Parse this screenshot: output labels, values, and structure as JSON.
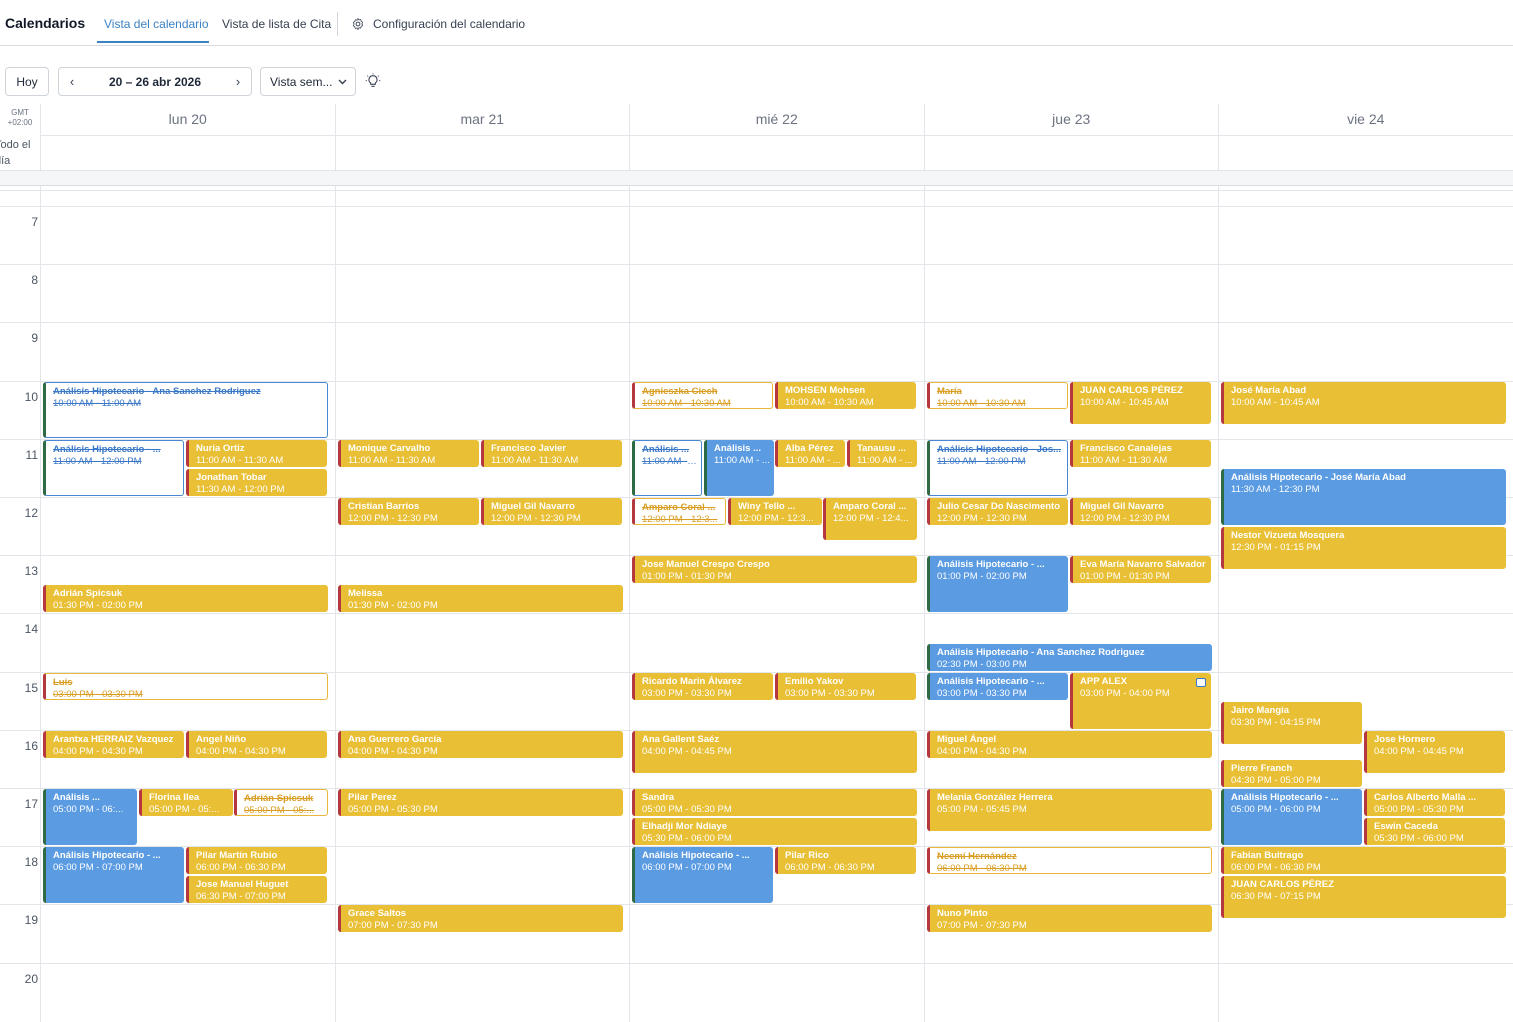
{
  "header": {
    "title": "Calendarios",
    "tabs": [
      {
        "label": "Vista del calendario"
      },
      {
        "label": "Vista de lista de Cita"
      },
      {
        "label": "Configuración del calendario"
      }
    ]
  },
  "toolbar": {
    "today_label": "Hoy",
    "date_range": "20 – 26 abr 2026",
    "prev_icon": "‹",
    "next_icon": "›",
    "view_select": "Vista sem...",
    "icons": [
      "gear-icon",
      "lightbulb-icon",
      "chevron-left-icon",
      "chevron-right-icon",
      "chevron-down-icon"
    ]
  },
  "grid": {
    "timezone": "GMT +02:00",
    "all_day_label": "Todo el día",
    "days": [
      "lun 20",
      "mar 21",
      "mié 22",
      "jue 23",
      "vie 24"
    ],
    "hours": [
      "7",
      "8",
      "9",
      "10",
      "11",
      "12",
      "13",
      "14",
      "15",
      "16",
      "17",
      "18",
      "19",
      "20"
    ]
  },
  "colors": {
    "accent": "#3b82c4",
    "event_yellow": "#e9bf35",
    "event_blue": "#5b9be2",
    "stripe_red": "#b6383f",
    "stripe_green": "#2f6a44"
  },
  "events": [
    {
      "day": 0,
      "start": 10,
      "end": 11,
      "col": 0,
      "cols": 1,
      "title": "Análisis Hipotecario - Ana Sanchez Rodriguez",
      "time": "10:00 AM - 11:00 AM",
      "style": "outline-blue",
      "strike": true
    },
    {
      "day": 0,
      "start": 11,
      "end": 12,
      "col": 0,
      "cols": 2,
      "title": "Análisis Hipotecario - ...",
      "time": "11:00 AM - 12:00 PM",
      "style": "outline-blue",
      "strike": true
    },
    {
      "day": 0,
      "start": 11,
      "end": 11.5,
      "col": 1,
      "cols": 2,
      "title": "Nuria Ortiz",
      "time": "11:00 AM - 11:30 AM",
      "style": "yellow"
    },
    {
      "day": 0,
      "start": 11.5,
      "end": 12,
      "col": 1,
      "cols": 2,
      "title": "Jonathan Tobar",
      "time": "11:30 AM - 12:00 PM",
      "style": "yellow"
    },
    {
      "day": 0,
      "start": 13.5,
      "end": 14,
      "col": 0,
      "cols": 1,
      "title": "Adrián Spicsuk",
      "time": "01:30 PM - 02:00 PM",
      "style": "yellow"
    },
    {
      "day": 0,
      "start": 15,
      "end": 15.5,
      "col": 0,
      "cols": 1,
      "title": "Luis",
      "time": "03:00 PM - 03:30 PM",
      "style": "outline-yellow",
      "strike": true
    },
    {
      "day": 0,
      "start": 16,
      "end": 16.5,
      "col": 0,
      "cols": 2,
      "title": "Arantxa HERRAIZ Vazquez",
      "time": "04:00 PM - 04:30 PM",
      "style": "yellow"
    },
    {
      "day": 0,
      "start": 16,
      "end": 16.5,
      "col": 1,
      "cols": 2,
      "title": "Angel Niño",
      "time": "04:00 PM - 04:30 PM",
      "style": "yellow"
    },
    {
      "day": 0,
      "start": 17,
      "end": 18,
      "col": 0,
      "cols": 3,
      "title": "Análisis ...",
      "time": "05:00 PM - 06:...",
      "style": "blue"
    },
    {
      "day": 0,
      "start": 17,
      "end": 17.5,
      "col": 1,
      "cols": 3,
      "title": "Florina Ilea",
      "time": "05:00 PM - 05:...",
      "style": "yellow"
    },
    {
      "day": 0,
      "start": 17,
      "end": 17.5,
      "col": 2,
      "cols": 3,
      "title": "Adrián Spicsuk",
      "time": "05:00 PM - 05:...",
      "style": "outline-yellow",
      "strike": true
    },
    {
      "day": 0,
      "start": 18,
      "end": 19,
      "col": 0,
      "cols": 2,
      "title": "Análisis Hipotecario - ...",
      "time": "06:00 PM - 07:00 PM",
      "style": "blue"
    },
    {
      "day": 0,
      "start": 18,
      "end": 18.5,
      "col": 1,
      "cols": 2,
      "title": "Pilar Martín Rubio",
      "time": "06:00 PM - 06:30 PM",
      "style": "yellow"
    },
    {
      "day": 0,
      "start": 18.5,
      "end": 19,
      "col": 1,
      "cols": 2,
      "title": "Jose Manuel Huguet",
      "time": "06:30 PM - 07:00 PM",
      "style": "yellow"
    },
    {
      "day": 1,
      "start": 11,
      "end": 11.5,
      "col": 0,
      "cols": 2,
      "title": "Monique Carvalho",
      "time": "11:00 AM - 11:30 AM",
      "style": "yellow"
    },
    {
      "day": 1,
      "start": 11,
      "end": 11.5,
      "col": 1,
      "cols": 2,
      "title": "Francisco Javier",
      "time": "11:00 AM - 11:30 AM",
      "style": "yellow"
    },
    {
      "day": 1,
      "start": 12,
      "end": 12.5,
      "col": 0,
      "cols": 2,
      "title": "Cristian Barrios",
      "time": "12:00 PM - 12:30 PM",
      "style": "yellow"
    },
    {
      "day": 1,
      "start": 12,
      "end": 12.5,
      "col": 1,
      "cols": 2,
      "title": "Miguel Gil Navarro",
      "time": "12:00 PM - 12:30 PM",
      "style": "yellow"
    },
    {
      "day": 1,
      "start": 13.5,
      "end": 14,
      "col": 0,
      "cols": 1,
      "title": "Melissa",
      "time": "01:30 PM - 02:00 PM",
      "style": "yellow"
    },
    {
      "day": 1,
      "start": 16,
      "end": 16.5,
      "col": 0,
      "cols": 1,
      "title": "Ana Guerrero García",
      "time": "04:00 PM - 04:30 PM",
      "style": "yellow"
    },
    {
      "day": 1,
      "start": 17,
      "end": 17.5,
      "col": 0,
      "cols": 1,
      "title": "Pilar Perez",
      "time": "05:00 PM - 05:30 PM",
      "style": "yellow"
    },
    {
      "day": 1,
      "start": 19,
      "end": 19.5,
      "col": 0,
      "cols": 1,
      "title": "Grace Saltos",
      "time": "07:00 PM - 07:30 PM",
      "style": "yellow"
    },
    {
      "day": 2,
      "start": 10,
      "end": 10.5,
      "col": 0,
      "cols": 2,
      "title": "Agnieszka Ciech",
      "time": "10:00 AM - 10:30 AM",
      "style": "outline-yellow",
      "strike": true
    },
    {
      "day": 2,
      "start": 10,
      "end": 10.5,
      "col": 1,
      "cols": 2,
      "title": "MOHSEN Mohsen",
      "time": "10:00 AM - 10:30 AM",
      "style": "yellow"
    },
    {
      "day": 2,
      "start": 11,
      "end": 12,
      "col": 0,
      "cols": 4,
      "title": "Análisis ...",
      "time": "11:00 AM - ...",
      "style": "outline-blue",
      "strike": true
    },
    {
      "day": 2,
      "start": 11,
      "end": 12,
      "col": 1,
      "cols": 4,
      "title": "Análisis ...",
      "time": "11:00 AM - ...",
      "style": "blue"
    },
    {
      "day": 2,
      "start": 11,
      "end": 11.5,
      "col": 2,
      "cols": 4,
      "title": "Alba Pérez",
      "time": "11:00 AM - ...",
      "style": "yellow"
    },
    {
      "day": 2,
      "start": 11,
      "end": 11.5,
      "col": 3,
      "cols": 4,
      "title": "Tanausu ...",
      "time": "11:00 AM - ...",
      "style": "yellow"
    },
    {
      "day": 2,
      "start": 12,
      "end": 12.5,
      "col": 0,
      "cols": 3,
      "title": "Amparo Coral ...",
      "time": "12:00 PM - 12:3...",
      "style": "outline-yellow",
      "strike": true
    },
    {
      "day": 2,
      "start": 12,
      "end": 12.5,
      "col": 1,
      "cols": 3,
      "title": "Winy Tello ...",
      "time": "12:00 PM - 12:3...",
      "style": "yellow"
    },
    {
      "day": 2,
      "start": 12,
      "end": 12.75,
      "col": 2,
      "cols": 3,
      "title": "Amparo Coral ...",
      "time": "12:00 PM - 12:4...",
      "style": "yellow"
    },
    {
      "day": 2,
      "start": 13,
      "end": 13.5,
      "col": 0,
      "cols": 1,
      "title": "Jose Manuel Crespo Crespo",
      "time": "01:00 PM - 01:30 PM",
      "style": "yellow"
    },
    {
      "day": 2,
      "start": 15,
      "end": 15.5,
      "col": 0,
      "cols": 2,
      "title": "Ricardo Marin Álvarez",
      "time": "03:00 PM - 03:30 PM",
      "style": "yellow"
    },
    {
      "day": 2,
      "start": 15,
      "end": 15.5,
      "col": 1,
      "cols": 2,
      "title": "Emilio Yakov",
      "time": "03:00 PM - 03:30 PM",
      "style": "yellow"
    },
    {
      "day": 2,
      "start": 16,
      "end": 16.75,
      "col": 0,
      "cols": 1,
      "title": "Ana Gallent Saéz",
      "time": "04:00 PM - 04:45 PM",
      "style": "yellow"
    },
    {
      "day": 2,
      "start": 17,
      "end": 17.5,
      "col": 0,
      "cols": 1,
      "title": "Sandra",
      "time": "05:00 PM - 05:30 PM",
      "style": "yellow"
    },
    {
      "day": 2,
      "start": 17.5,
      "end": 18,
      "col": 0,
      "cols": 1,
      "title": "Elhadji Mor Ndiaye",
      "time": "05:30 PM - 06:00 PM",
      "style": "yellow"
    },
    {
      "day": 2,
      "start": 18,
      "end": 19,
      "col": 0,
      "cols": 2,
      "title": "Análisis Hipotecario - ...",
      "time": "06:00 PM - 07:00 PM",
      "style": "blue"
    },
    {
      "day": 2,
      "start": 18,
      "end": 18.5,
      "col": 1,
      "cols": 2,
      "title": "Pilar Rico",
      "time": "06:00 PM - 06:30 PM",
      "style": "yellow"
    },
    {
      "day": 3,
      "start": 10,
      "end": 10.5,
      "col": 0,
      "cols": 2,
      "title": "María",
      "time": "10:00 AM - 10:30 AM",
      "style": "outline-yellow",
      "strike": true
    },
    {
      "day": 3,
      "start": 10,
      "end": 10.75,
      "col": 1,
      "cols": 2,
      "title": "JUAN CARLOS PÉREZ",
      "time": "10:00 AM - 10:45 AM",
      "style": "yellow"
    },
    {
      "day": 3,
      "start": 11,
      "end": 12,
      "col": 0,
      "cols": 2,
      "title": "Análisis Hipotecario - Jos...",
      "time": "11:00 AM - 12:00 PM",
      "style": "outline-blue",
      "strike": true
    },
    {
      "day": 3,
      "start": 11,
      "end": 11.5,
      "col": 1,
      "cols": 2,
      "title": "Francisco Canalejas",
      "time": "11:00 AM - 11:30 AM",
      "style": "yellow"
    },
    {
      "day": 3,
      "start": 12,
      "end": 12.5,
      "col": 0,
      "cols": 2,
      "title": "Julio Cesar Do Nascimento",
      "time": "12:00 PM - 12:30 PM",
      "style": "yellow"
    },
    {
      "day": 3,
      "start": 12,
      "end": 12.5,
      "col": 1,
      "cols": 2,
      "title": "Miguel Gil Navarro",
      "time": "12:00 PM - 12:30 PM",
      "style": "yellow"
    },
    {
      "day": 3,
      "start": 13,
      "end": 14,
      "col": 0,
      "cols": 2,
      "title": "Análisis Hipotecario - ...",
      "time": "01:00 PM - 02:00 PM",
      "style": "blue"
    },
    {
      "day": 3,
      "start": 13,
      "end": 13.5,
      "col": 1,
      "cols": 2,
      "title": "Eva María Navarro Salvador",
      "time": "01:00 PM - 01:30 PM",
      "style": "yellow"
    },
    {
      "day": 3,
      "start": 14.5,
      "end": 15,
      "col": 0,
      "cols": 1,
      "title": "Análisis Hipotecario - Ana Sanchez Rodriguez",
      "time": "02:30 PM - 03:00 PM",
      "style": "blue"
    },
    {
      "day": 3,
      "start": 15,
      "end": 15.5,
      "col": 0,
      "cols": 2,
      "title": "Análisis Hipotecario - ...",
      "time": "03:00 PM - 03:30 PM",
      "style": "blue"
    },
    {
      "day": 3,
      "start": 15,
      "end": 16,
      "col": 1,
      "cols": 2,
      "title": "APP ALEX",
      "time": "03:00 PM - 04:00 PM",
      "style": "yellow",
      "chat": true
    },
    {
      "day": 3,
      "start": 16,
      "end": 16.5,
      "col": 0,
      "cols": 1,
      "title": "Miguel Ángel",
      "time": "04:00 PM - 04:30 PM",
      "style": "yellow"
    },
    {
      "day": 3,
      "start": 17,
      "end": 17.75,
      "col": 0,
      "cols": 1,
      "title": "Melania González Herrera",
      "time": "05:00 PM - 05:45 PM",
      "style": "yellow"
    },
    {
      "day": 3,
      "start": 18,
      "end": 18.5,
      "col": 0,
      "cols": 1,
      "title": "Neemí Hernández",
      "time": "06:00 PM - 06:30 PM",
      "style": "outline-yellow",
      "strike": true
    },
    {
      "day": 3,
      "start": 19,
      "end": 19.5,
      "col": 0,
      "cols": 1,
      "title": "Nuno Pinto",
      "time": "07:00 PM - 07:30 PM",
      "style": "yellow"
    },
    {
      "day": 4,
      "start": 10,
      "end": 10.75,
      "col": 0,
      "cols": 1,
      "title": "José María Abad",
      "time": "10:00 AM - 10:45 AM",
      "style": "yellow"
    },
    {
      "day": 4,
      "start": 11.5,
      "end": 12.5,
      "col": 0,
      "cols": 1,
      "title": "Análisis Hipotecario - José María Abad",
      "time": "11:30 AM - 12:30 PM",
      "style": "blue"
    },
    {
      "day": 4,
      "start": 12.5,
      "end": 13.25,
      "col": 0,
      "cols": 1,
      "title": "Nestor Vizueta Mosquera",
      "time": "12:30 PM - 01:15 PM",
      "style": "yellow"
    },
    {
      "day": 4,
      "start": 15.5,
      "end": 16.25,
      "col": 0,
      "cols": 2,
      "title": "Jairo Mangia",
      "time": "03:30 PM - 04:15 PM",
      "style": "yellow"
    },
    {
      "day": 4,
      "start": 16,
      "end": 16.75,
      "col": 1,
      "cols": 2,
      "title": "Jose Hornero",
      "time": "04:00 PM - 04:45 PM",
      "style": "yellow"
    },
    {
      "day": 4,
      "start": 16.5,
      "end": 17,
      "col": 0,
      "cols": 2,
      "title": "Pierre Franch",
      "time": "04:30 PM - 05:00 PM",
      "style": "yellow"
    },
    {
      "day": 4,
      "start": 17,
      "end": 18,
      "col": 0,
      "cols": 2,
      "title": "Análisis Hipotecario - ...",
      "time": "05:00 PM - 06:00 PM",
      "style": "blue"
    },
    {
      "day": 4,
      "start": 17,
      "end": 17.5,
      "col": 1,
      "cols": 2,
      "title": "Carlos Alberto Malla ...",
      "time": "05:00 PM - 05:30 PM",
      "style": "yellow"
    },
    {
      "day": 4,
      "start": 17.5,
      "end": 18,
      "col": 1,
      "cols": 2,
      "title": "Eswin Caceda",
      "time": "05:30 PM - 06:00 PM",
      "style": "yellow"
    },
    {
      "day": 4,
      "start": 18,
      "end": 18.5,
      "col": 0,
      "cols": 1,
      "title": "Fabian Buitrago",
      "time": "06:00 PM - 06:30 PM",
      "style": "yellow"
    },
    {
      "day": 4,
      "start": 18.5,
      "end": 19.25,
      "col": 0,
      "cols": 1,
      "title": "JUAN CARLOS PÉREZ",
      "time": "06:30 PM - 07:15 PM",
      "style": "yellow"
    }
  ]
}
